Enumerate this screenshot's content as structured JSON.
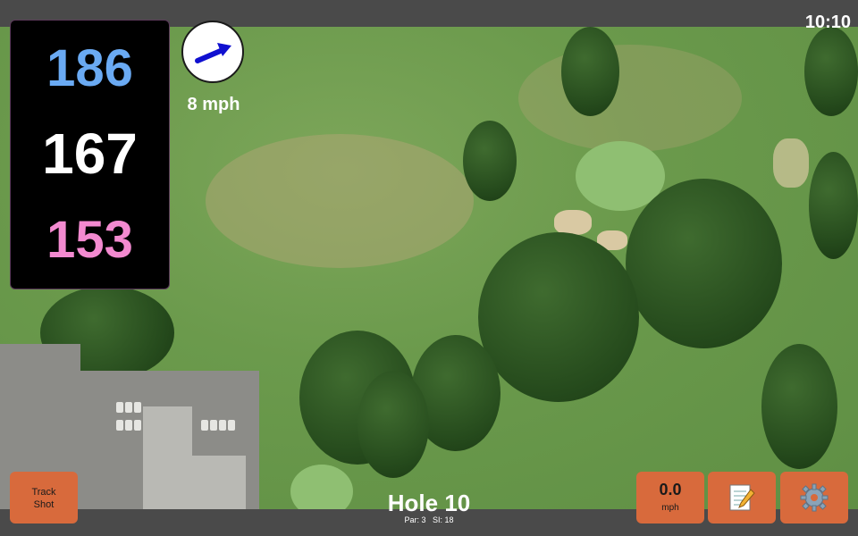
{
  "status": {
    "clock": "10:10"
  },
  "distances": {
    "back": "186",
    "middle": "167",
    "front": "153"
  },
  "wind": {
    "speed_label": "8 mph",
    "icon": "wind-arrow-icon"
  },
  "hole": {
    "title": "Hole 10",
    "par": "Par: 3",
    "si": "SI: 18"
  },
  "buttons": {
    "track_shot": "Track\nShot",
    "speed_value": "0.0",
    "speed_unit": "mph",
    "notes_icon": "notepad-icon",
    "settings_icon": "gear-icon"
  },
  "colors": {
    "back": "#6aaaf3",
    "middle": "#ffffff",
    "front": "#f38ad0",
    "accent": "#d86a3c"
  }
}
